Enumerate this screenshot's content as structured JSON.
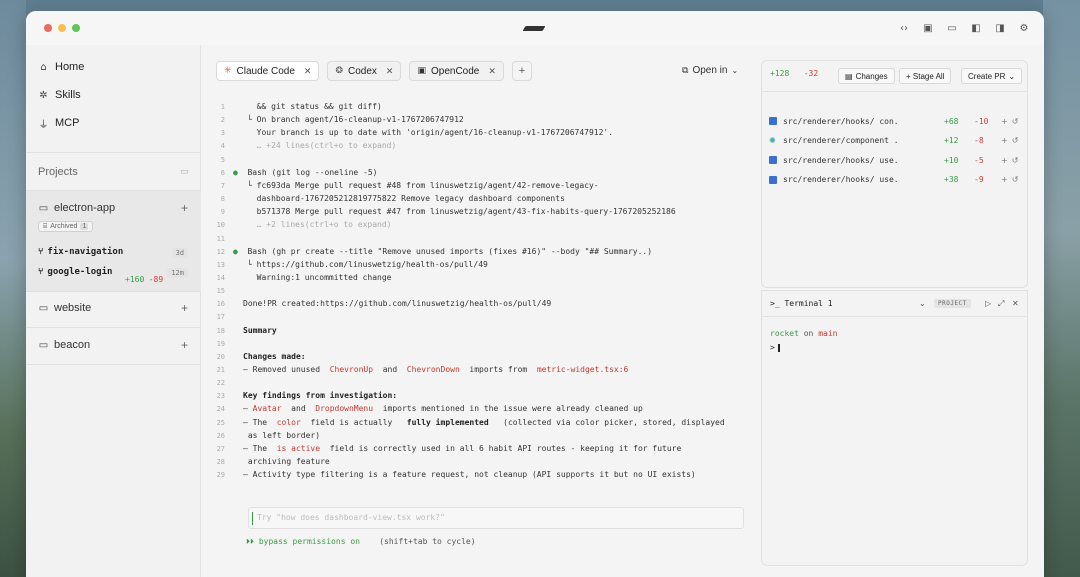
{
  "sidebar": {
    "nav": [
      {
        "label": "Home",
        "icon": "home-icon"
      },
      {
        "label": "Skills",
        "icon": "puzzle-icon"
      },
      {
        "label": "MCP",
        "icon": "plug-icon"
      }
    ],
    "projects_label": "Projects",
    "projects": [
      {
        "name": "electron-app",
        "archived_label": "Archived",
        "archived_count": "1",
        "branches": [
          {
            "name": "fix-navigation",
            "age": "3d",
            "add": "",
            "del": ""
          },
          {
            "name": "google-login",
            "age": "12m",
            "add": "+160",
            "del": "-89"
          }
        ]
      },
      {
        "name": "website"
      },
      {
        "name": "beacon"
      }
    ]
  },
  "tabs": [
    {
      "label": "Claude Code",
      "icon": "claude-icon",
      "active": true
    },
    {
      "label": "Codex",
      "icon": "codex-icon",
      "active": false
    },
    {
      "label": "OpenCode",
      "icon": "opencode-icon",
      "active": false
    }
  ],
  "open_in_label": "Open in",
  "code_lines": [
    {
      "n": "1",
      "t": "  && git status && git diff)",
      "c": ""
    },
    {
      "n": "2",
      "t": "└ On branch agent/16-cleanup-v1-1767206747912",
      "c": ""
    },
    {
      "n": "3",
      "t": "  Your branch is up to date with 'origin/agent/16-cleanup-v1-1767206747912'.",
      "c": ""
    },
    {
      "n": "4",
      "t": "  … +24 lines(ctrl+o to expand)",
      "c": "dim"
    },
    {
      "n": "5",
      "t": "",
      "c": ""
    },
    {
      "n": "6",
      "t": "Bash (git log --oneline -5)",
      "c": "bash"
    },
    {
      "n": "7",
      "t": "└ fc693da Merge pull request #48 from linuswetzig/agent/42-remove-legacy-",
      "c": ""
    },
    {
      "n": "8",
      "t": "  dashboard-1767205212819775822 Remove legacy dashboard components",
      "c": ""
    },
    {
      "n": "9",
      "t": "  b571378 Merge pull request #47 from linuswetzig/agent/43-fix-habits-query-1767205252186",
      "c": ""
    },
    {
      "n": "10",
      "t": "  … +2 lines(ctrl+o to expand)",
      "c": "dim"
    },
    {
      "n": "11",
      "t": "",
      "c": ""
    },
    {
      "n": "12",
      "t": "Bash (gh pr create --title \"Remove unused imports (fixes #16)\" --body \"## Summary..)",
      "c": "bash"
    },
    {
      "n": "13",
      "t": "└ https://github.com/linuswetzig/health-os/pull/49",
      "c": ""
    },
    {
      "n": "14",
      "t": "  Warning:1 uncommitted change",
      "c": ""
    },
    {
      "n": "15",
      "t": "",
      "c": ""
    },
    {
      "n": "16",
      "t": "Done!PR created:https://github.com/linuswetzig/health-os/pull/49",
      "c": "plain"
    },
    {
      "n": "17",
      "t": "",
      "c": ""
    },
    {
      "n": "18",
      "t": "Summary",
      "c": "bold"
    },
    {
      "n": "19",
      "t": "",
      "c": ""
    },
    {
      "n": "20",
      "t": "Changes made:",
      "c": "bold"
    },
    {
      "n": "21",
      "t": "",
      "c": "rich21"
    },
    {
      "n": "22",
      "t": "",
      "c": ""
    },
    {
      "n": "23",
      "t": "Key findings from investigation:",
      "c": "bold"
    },
    {
      "n": "24",
      "t": "",
      "c": "rich24"
    },
    {
      "n": "25",
      "t": "",
      "c": "rich25"
    },
    {
      "n": "26",
      "t": " as left border)",
      "c": "plain"
    },
    {
      "n": "27",
      "t": "",
      "c": "rich27"
    },
    {
      "n": "28",
      "t": " archiving feature",
      "c": "plain"
    },
    {
      "n": "29",
      "t": "– Activity type filtering is a feature request, not cleanup (API supports it but no UI exists)",
      "c": "plain"
    }
  ],
  "rich": {
    "l21": [
      "– Removed unused  ",
      "ChevronUp",
      "  and  ",
      "ChevronDown",
      "  imports from  ",
      "metric-widget.tsx:6"
    ],
    "l24": [
      "– ",
      "Avatar",
      "  and  ",
      "DropdownMenu",
      "  imports mentioned in the issue were already cleaned up"
    ],
    "l25": [
      "– The  ",
      "color",
      "  field is actually   ",
      "fully implemented",
      "   (collected via color picker, stored, displayed"
    ],
    "l27": [
      "– The  ",
      "is active",
      "  field is correctly used in all 6 habit API routes - keeping it for future"
    ]
  },
  "input": {
    "placeholder": "Try \"how does dashboard-view.tsx work?\""
  },
  "bypass": {
    "label": "⏵⏵ bypass permissions on",
    "hint": "(shift+tab to cycle)"
  },
  "changes": {
    "add": "+128",
    "del": "-32",
    "changes_label": "Changes",
    "stage_all_label": "+ Stage All",
    "create_pr_label": "Create PR",
    "files": [
      {
        "path": "src/renderer/hooks/  con...",
        "add": "+68",
        "del": "-10",
        "icon": "file-icon"
      },
      {
        "path": "src/renderer/component  ...",
        "add": "+12",
        "del": "-8",
        "icon": "gear-icon"
      },
      {
        "path": "src/renderer/hooks/  use...",
        "add": "+10",
        "del": "-5",
        "icon": "file-icon"
      },
      {
        "path": "src/renderer/hooks/  use...",
        "add": "+38",
        "del": "-9",
        "icon": "file-icon"
      }
    ]
  },
  "terminal": {
    "title": ">_  Terminal 1",
    "tag": "PROJECT",
    "prompt_user": "rocket",
    "prompt_on": "on",
    "prompt_branch": "main",
    "prompt_symbol": ">"
  },
  "colors": {
    "add": "#3b9b46",
    "del": "#cf3e3e",
    "keyword": "#c03a30",
    "accent": "#3b6fd0"
  }
}
